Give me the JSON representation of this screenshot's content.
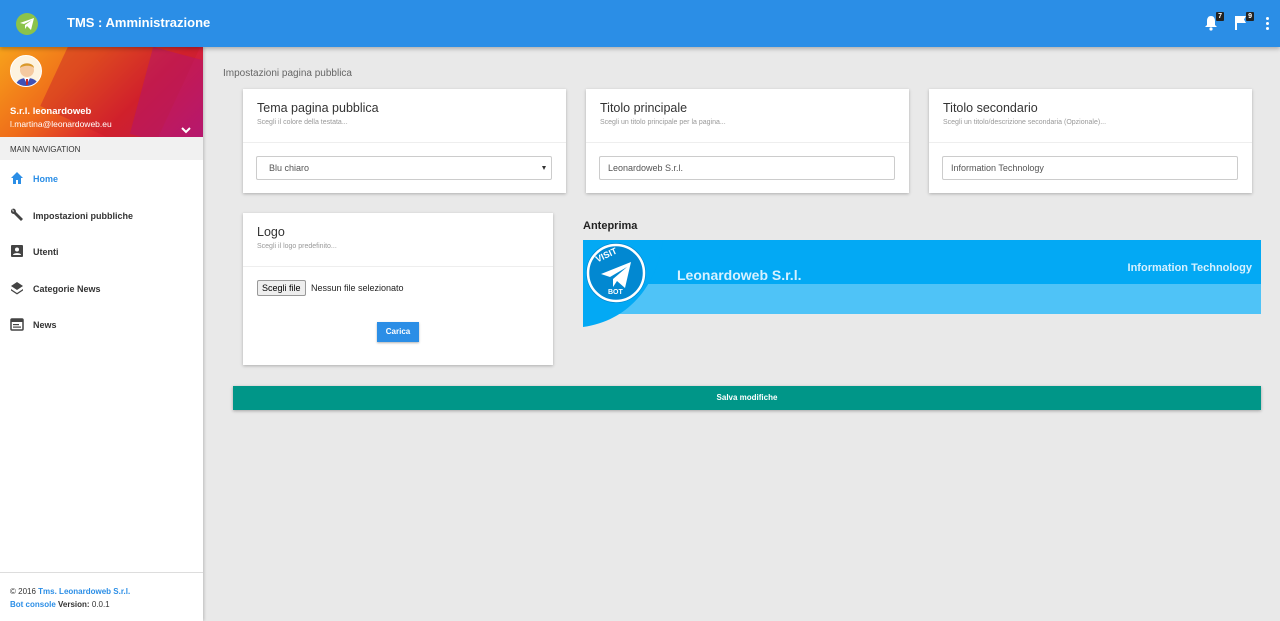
{
  "header": {
    "title": "TMS : Amministrazione",
    "notifications_count": "7",
    "flags_count": "9"
  },
  "sidebar": {
    "user_name": "S.r.l. leonardoweb",
    "user_email": "l.martina@leonardoweb.eu",
    "nav_header": "MAIN NAVIGATION",
    "items": [
      {
        "label": "Home",
        "icon": "home-icon",
        "active": true
      },
      {
        "label": "Impostazioni pubbliche",
        "icon": "wrench-icon"
      },
      {
        "label": "Utenti",
        "icon": "contact-icon"
      },
      {
        "label": "Categorie News",
        "icon": "layers-icon"
      },
      {
        "label": "News",
        "icon": "calendar-icon"
      }
    ],
    "footer": {
      "copyright": "© 2016",
      "company": "Tms. Leonardoweb S.r.l.",
      "console": "Bot console",
      "version_label": "Version:",
      "version": "0.0.1"
    }
  },
  "main": {
    "section_title": "Impostazioni pagina pubblica",
    "theme_card": {
      "title": "Tema pagina pubblica",
      "subtitle": "Scegli il colore della testata...",
      "selected": "Blu chiaro"
    },
    "main_title_card": {
      "title": "Titolo principale",
      "subtitle": "Scegli un titolo principale per la pagina...",
      "value": "Leonardoweb S.r.l."
    },
    "secondary_title_card": {
      "title": "Titolo secondario",
      "subtitle": "Scegli un titolo/descrizione secondaria (Opzionale)...",
      "value": "Information Technology"
    },
    "logo_card": {
      "title": "Logo",
      "subtitle": "Scegli il logo predefinito...",
      "file_button": "Scegli file",
      "file_status": "Nessun file selezionato",
      "upload_button": "Carica"
    },
    "preview": {
      "label": "Anteprima",
      "title": "Leonardoweb S.r.l.",
      "subtitle": "Information Technology",
      "logo_top_text": "VISIT",
      "logo_bottom_text": "BOT"
    },
    "save_button": "Salva modifiche"
  },
  "colors": {
    "primary": "#2b8ee6",
    "preview_dark": "#03a9f4",
    "preview_light": "#4fc3f7",
    "save": "#009688"
  }
}
